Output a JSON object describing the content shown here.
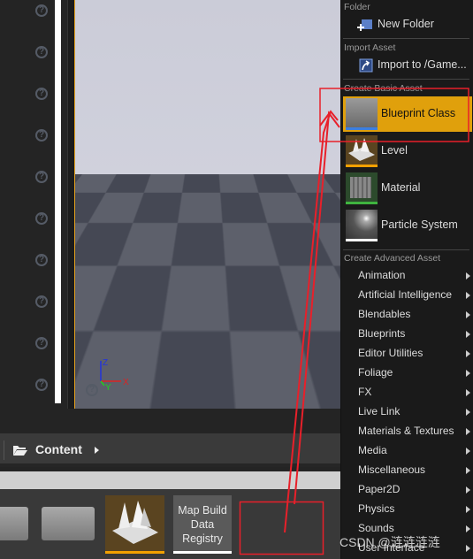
{
  "left_panel": {
    "help_icon_count": 10
  },
  "viewport": {
    "axis": {
      "x": "X",
      "y": "Y",
      "z": "Z"
    }
  },
  "path_bar": {
    "folder": "Content"
  },
  "assets": {
    "map_build_tile": "Map Build Data Registry"
  },
  "menu": {
    "folder_section": "Folder",
    "new_folder": "New Folder",
    "import_section": "Import Asset",
    "import": "Import to /Game...",
    "basic_section": "Create Basic Asset",
    "basic": [
      {
        "label": "Blueprint Class",
        "accent": "#3c7fe0",
        "highlighted": true
      },
      {
        "label": "Level",
        "accent": "#f2a000"
      },
      {
        "label": "Material",
        "accent": "#3fb43f"
      },
      {
        "label": "Particle System",
        "accent": "#ffffff"
      }
    ],
    "advanced_section": "Create Advanced Asset",
    "advanced": [
      "Animation",
      "Artificial Intelligence",
      "Blendables",
      "Blueprints",
      "Editor Utilities",
      "Foliage",
      "FX",
      "Live Link",
      "Materials & Textures",
      "Media",
      "Miscellaneous",
      "Paper2D",
      "Physics",
      "Sounds",
      "User Interface"
    ]
  },
  "colors": {
    "highlight": "#e0a00c",
    "annotation": "#e8202a",
    "viewport_border": "#e5a21e"
  },
  "watermark": "CSDN @涟涟涟涟"
}
